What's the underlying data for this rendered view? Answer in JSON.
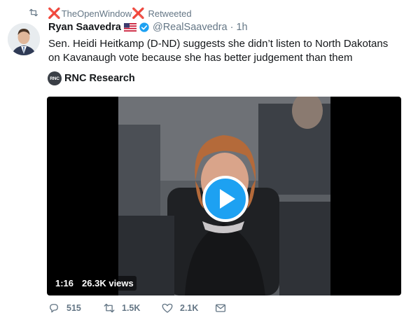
{
  "retweet": {
    "icon": "retweet-icon",
    "mark": "❌",
    "account": "TheOpenWindow",
    "label": "Retweeted"
  },
  "author": {
    "display_name": "Ryan Saavedra",
    "flag": "us-flag-icon",
    "verified_icon": "verified-badge-icon",
    "handle": "@RealSaavedra",
    "separator": "·",
    "time": "1h"
  },
  "tweet": {
    "text": "Sen. Heidi Heitkamp (D-ND) suggests she didn’t listen to North Dakotans on Kavanaugh vote because she has better judgement than them"
  },
  "source": {
    "logo_text": "RNC",
    "name": "RNC Research"
  },
  "video": {
    "duration": "1:16",
    "views": "26.3K views",
    "play_icon": "play-icon",
    "accent": "#1da1f2"
  },
  "actions": {
    "reply_count": "515",
    "retweet_count": "1.5K",
    "like_count": "2.1K"
  },
  "colors": {
    "text": "#14171a",
    "muted": "#657786",
    "x_mark": "#e0245e"
  }
}
